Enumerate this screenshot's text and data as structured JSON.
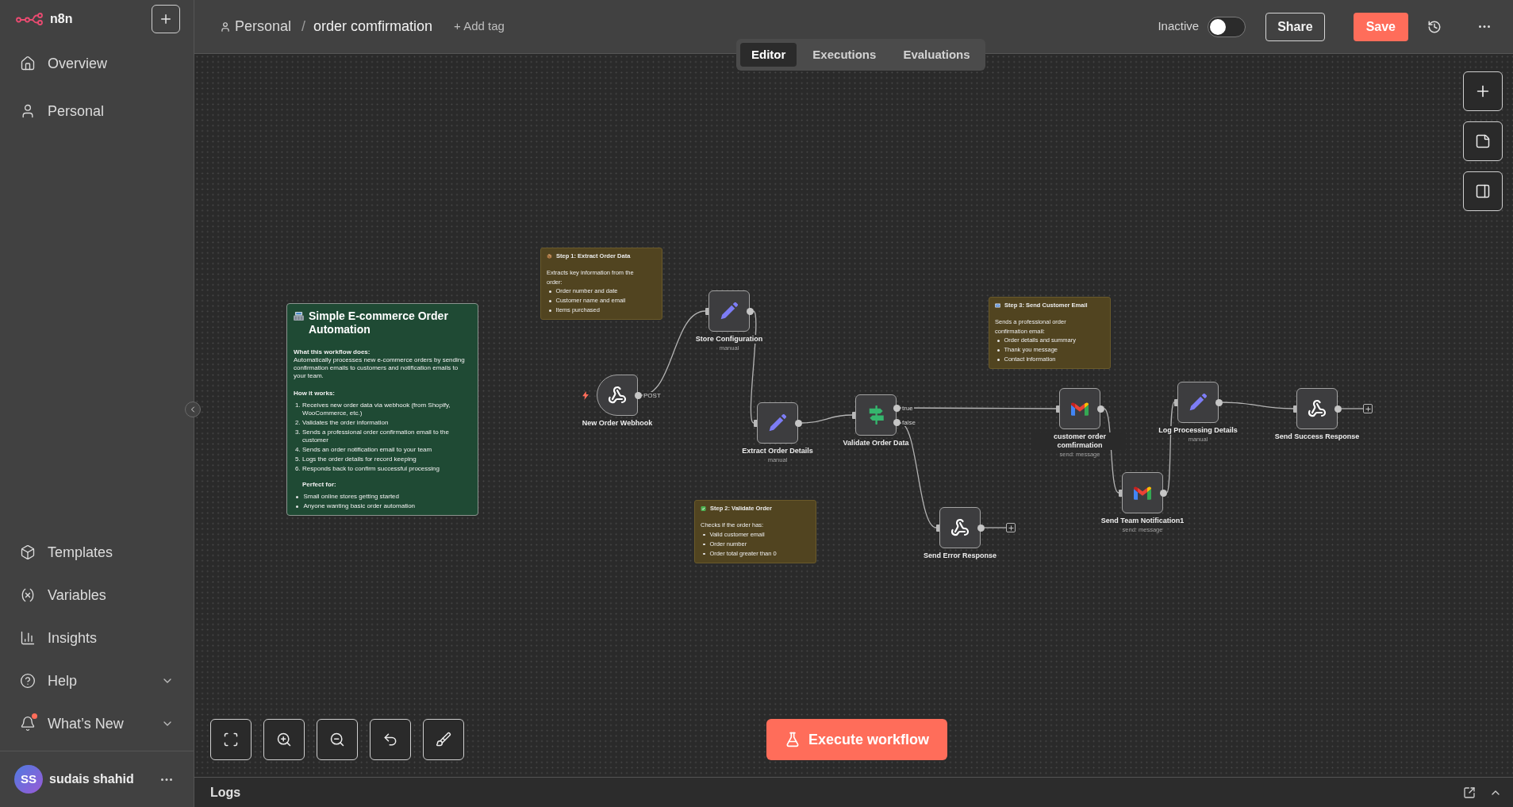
{
  "sidebar": {
    "logo_text": "n8n",
    "nav_top": [
      {
        "label": "Overview"
      },
      {
        "label": "Personal"
      }
    ],
    "nav_bottom": [
      {
        "kind": "link",
        "label": "Templates",
        "notification": false
      },
      {
        "kind": "link",
        "label": "Variables",
        "notification": false
      },
      {
        "kind": "link",
        "label": "Insights",
        "notification": false
      },
      {
        "kind": "menu",
        "label": "Help",
        "notification": false
      },
      {
        "kind": "menu",
        "label": "What’s New",
        "notification": true
      }
    ],
    "user": {
      "initials": "SS",
      "name": "sudais shahid"
    }
  },
  "header": {
    "project": "Personal",
    "separator": "/",
    "workflow_name": "order comfirmation",
    "add_tag": "+ Add tag",
    "status_label": "Inactive",
    "active": false,
    "share": "Share",
    "save": "Save"
  },
  "view_tabs": [
    {
      "label": "Editor",
      "selected": true
    },
    {
      "label": "Executions",
      "selected": false
    },
    {
      "label": "Evaluations",
      "selected": false
    }
  ],
  "canvas": {
    "sticky_notes": [
      {
        "kind": "overview",
        "color": "#1f4a34",
        "title": "Simple E-commerce Order Automation",
        "blocks": [
          {
            "kind": "heading",
            "text": "What this workflow does:"
          },
          {
            "kind": "paragraph",
            "text": "Automatically processes new e-commerce orders by sending confirmation emails to customers and notification emails to your team."
          },
          {
            "kind": "heading",
            "text": "How it works:"
          },
          {
            "kind": "numbered",
            "items": [
              {
                "number": "1.",
                "text": "Receives new order data via webhook (from Shopify, WooCommerce, etc.)"
              },
              {
                "number": "2.",
                "text": "Validates the order information"
              },
              {
                "number": "3.",
                "text": "Sends a professional order confirmation email to the customer"
              },
              {
                "number": "4.",
                "text": "Sends an order notification email to your team"
              },
              {
                "number": "5.",
                "text": "Logs the order details for record keeping"
              },
              {
                "number": "6.",
                "text": "Responds back to confirm successful processing"
              }
            ]
          },
          {
            "kind": "subheading",
            "text": "Perfect for:"
          },
          {
            "kind": "bullets",
            "items": [
              "Small online stores getting started",
              "Anyone wanting basic order automation"
            ]
          }
        ]
      },
      {
        "kind": "step",
        "color": "#514420",
        "title": "Step 1: Extract Order Data",
        "blocks": [
          {
            "kind": "paragraph",
            "text": "Extracts key information from the order:"
          },
          {
            "kind": "bullets",
            "items": [
              "Order number and date",
              "Customer name and email",
              "Items purchased"
            ]
          }
        ]
      },
      {
        "kind": "step",
        "color": "#514420",
        "title": "Step 2: Validate Order",
        "blocks": [
          {
            "kind": "paragraph",
            "text": "Checks if the order has:"
          },
          {
            "kind": "bullets",
            "items": [
              "Valid customer email",
              "Order number",
              "Order total greater than 0"
            ]
          }
        ]
      },
      {
        "kind": "step",
        "color": "#514420",
        "title": "Step 3: Send Customer Email",
        "blocks": [
          {
            "kind": "paragraph",
            "text": "Sends a professional order confirmation email:"
          },
          {
            "kind": "bullets",
            "items": [
              "Order details and summary",
              "Thank you message",
              "Contact information"
            ]
          }
        ]
      }
    ],
    "nodes": [
      {
        "kind": "trigger",
        "name": "New Order Webhook",
        "output_label": "POST"
      },
      {
        "kind": "set",
        "name": "Store Configuration",
        "subtitle": "manual"
      },
      {
        "kind": "set",
        "name": "Extract Order Details",
        "subtitle": "manual"
      },
      {
        "kind": "if",
        "name": "Validate Order Data",
        "outputs": [
          "true",
          "false"
        ]
      },
      {
        "kind": "gmail",
        "name": "customer order comfirmation",
        "subtitle": "send: message"
      },
      {
        "kind": "gmail",
        "name": "Send Team Notification1",
        "subtitle": "send: message"
      },
      {
        "kind": "set",
        "name": "Log Processing Details",
        "subtitle": "manual"
      },
      {
        "kind": "respond",
        "name": "Send Success Response"
      },
      {
        "kind": "respond",
        "name": "Send Error Response"
      }
    ]
  },
  "execute_button": "Execute workflow",
  "logs_panel": {
    "title": "Logs"
  }
}
